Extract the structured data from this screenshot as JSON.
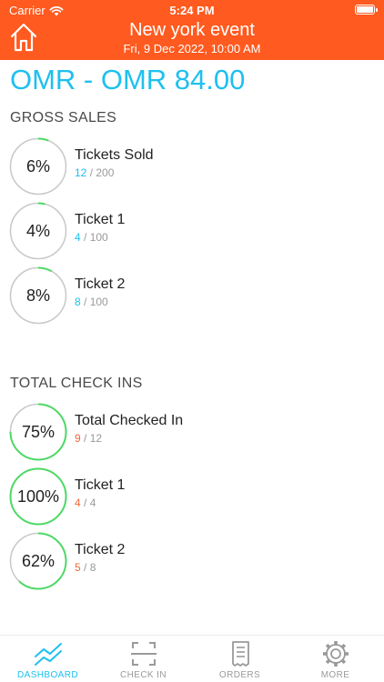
{
  "status": {
    "carrier": "Carrier",
    "time": "5:24 PM"
  },
  "header": {
    "title": "New york event",
    "subtitle": "Fri, 9 Dec 2022, 10:00 AM",
    "home_icon": "home-icon"
  },
  "price_range": "OMR - OMR 84.00",
  "colors": {
    "accent": "#ff5a1f",
    "primary": "#1ec0ef",
    "progress": "#4cd964",
    "checkin_count": "#f06a3a",
    "ring_track": "#c8c8c8"
  },
  "gross_sales": {
    "title": "GROSS SALES",
    "items": [
      {
        "name": "Tickets Sold",
        "percent_label": "6%",
        "fraction": 0.06,
        "count": "12",
        "total": "200"
      },
      {
        "name": "Ticket 1",
        "percent_label": "4%",
        "fraction": 0.04,
        "count": "4",
        "total": "100"
      },
      {
        "name": "Ticket 2",
        "percent_label": "8%",
        "fraction": 0.08,
        "count": "8",
        "total": "100"
      }
    ]
  },
  "check_ins": {
    "title": "TOTAL CHECK INS",
    "items": [
      {
        "name": "Total Checked In",
        "percent_label": "75%",
        "fraction": 0.75,
        "count": "9",
        "total": "12"
      },
      {
        "name": "Ticket 1",
        "percent_label": "100%",
        "fraction": 1.0,
        "count": "4",
        "total": "4"
      },
      {
        "name": "Ticket 2",
        "percent_label": "62%",
        "fraction": 0.62,
        "count": "5",
        "total": "8"
      }
    ]
  },
  "tabs": [
    {
      "label": "DASHBOARD",
      "icon": "chart-line-icon",
      "active": true
    },
    {
      "label": "CHECK IN",
      "icon": "scan-icon",
      "active": false
    },
    {
      "label": "ORDERS",
      "icon": "receipt-icon",
      "active": false
    },
    {
      "label": "MORE",
      "icon": "gear-icon",
      "active": false
    }
  ]
}
